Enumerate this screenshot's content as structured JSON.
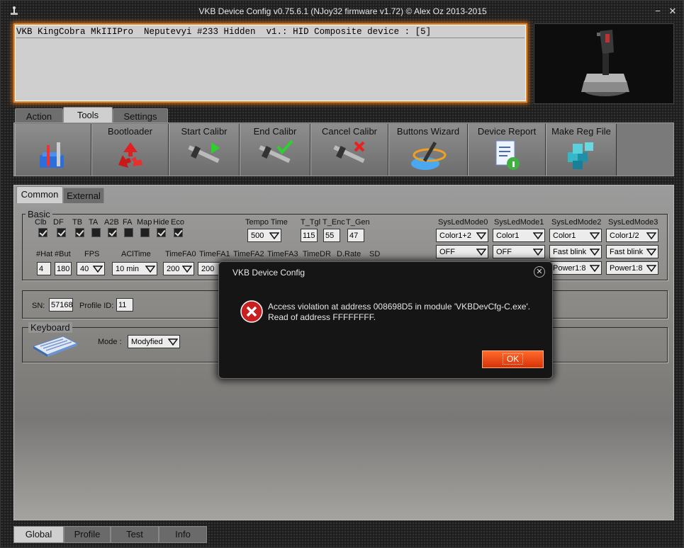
{
  "window": {
    "title": "VKB Device Config v0.75.6.1 (NJoy32 firmware v1.72) © Alex Oz 2013-2015",
    "minimize": "−",
    "close": "✕"
  },
  "device_line": "VKB KingCobra MkIIIPro  Neputevyi #233 Hidden  v1.: HID Composite device : [5]",
  "top_tabs": [
    "Action",
    "Tools",
    "Settings"
  ],
  "tools": [
    "Bootloader",
    "Start Calibr",
    "End Calibr",
    "Cancel Calibr",
    "Buttons Wizard",
    "Device Report",
    "Make Reg File"
  ],
  "sub_tabs": [
    "Common",
    "External"
  ],
  "basic": {
    "title": "Basic",
    "flags": [
      {
        "label": "Clb",
        "checked": true
      },
      {
        "label": "DF",
        "checked": true
      },
      {
        "label": "TB",
        "checked": true
      },
      {
        "label": "TA",
        "checked": false
      },
      {
        "label": "A2B",
        "checked": true
      },
      {
        "label": "FA",
        "checked": false
      },
      {
        "label": "Map",
        "checked": false
      },
      {
        "label": "Hide",
        "checked": true
      },
      {
        "label": "Eco",
        "checked": true
      }
    ],
    "tempo_label": "Tempo Time",
    "tempo_value": "500",
    "t_tgl_label": "T_Tgl",
    "t_tgl_value": "115",
    "t_enc_label": "T_Enc",
    "t_enc_value": "55",
    "t_gen_label": "T_Gen",
    "t_gen_value": "47",
    "hat_label": "#Hat",
    "hat_value": "4",
    "but_label": "#But",
    "but_value": "180",
    "fps_label": "FPS",
    "fps_value": "40",
    "acl_label": "AClTime",
    "acl_value": "10 min",
    "tfa0_label": "TimeFA0",
    "tfa0_value": "200",
    "tfa1_label": "TimeFA1",
    "tfa1_value": "200",
    "tfa2_label": "TimeFA2",
    "tfa3_label": "TimeFA3",
    "tdr_label": "TimeDR",
    "drate_label": "D.Rate",
    "sd_label": "SD",
    "sysled": [
      {
        "label": "SysLedMode0",
        "v1": "Color1+2",
        "v2": "OFF",
        "v3": ""
      },
      {
        "label": "SysLedMode1",
        "v1": "Color1",
        "v2": "OFF",
        "v3": ""
      },
      {
        "label": "SysLedMode2",
        "v1": "Color1",
        "v2": "Fast blink",
        "v3": "Power1:8"
      },
      {
        "label": "SysLedMode3",
        "v1": "Color1/2",
        "v2": "Fast blink",
        "v3": "Power1:8"
      }
    ]
  },
  "sn_label": "SN:",
  "sn_value": "57168",
  "profile_id_label": "Profile ID:",
  "profile_id_value": "11",
  "keyboard": {
    "title": "Keyboard",
    "mode_label": "Mode :",
    "mode_value": "Modyfied"
  },
  "bottom_tabs": [
    "Global",
    "Profile",
    "Test",
    "Info"
  ],
  "dialog": {
    "title": "VKB Device Config",
    "close": "✕",
    "line1": "Access violation at address 008698D5 in module 'VKBDevCfg-C.exe'.",
    "line2": "Read of address FFFFFFFF.",
    "ok": "OK"
  }
}
